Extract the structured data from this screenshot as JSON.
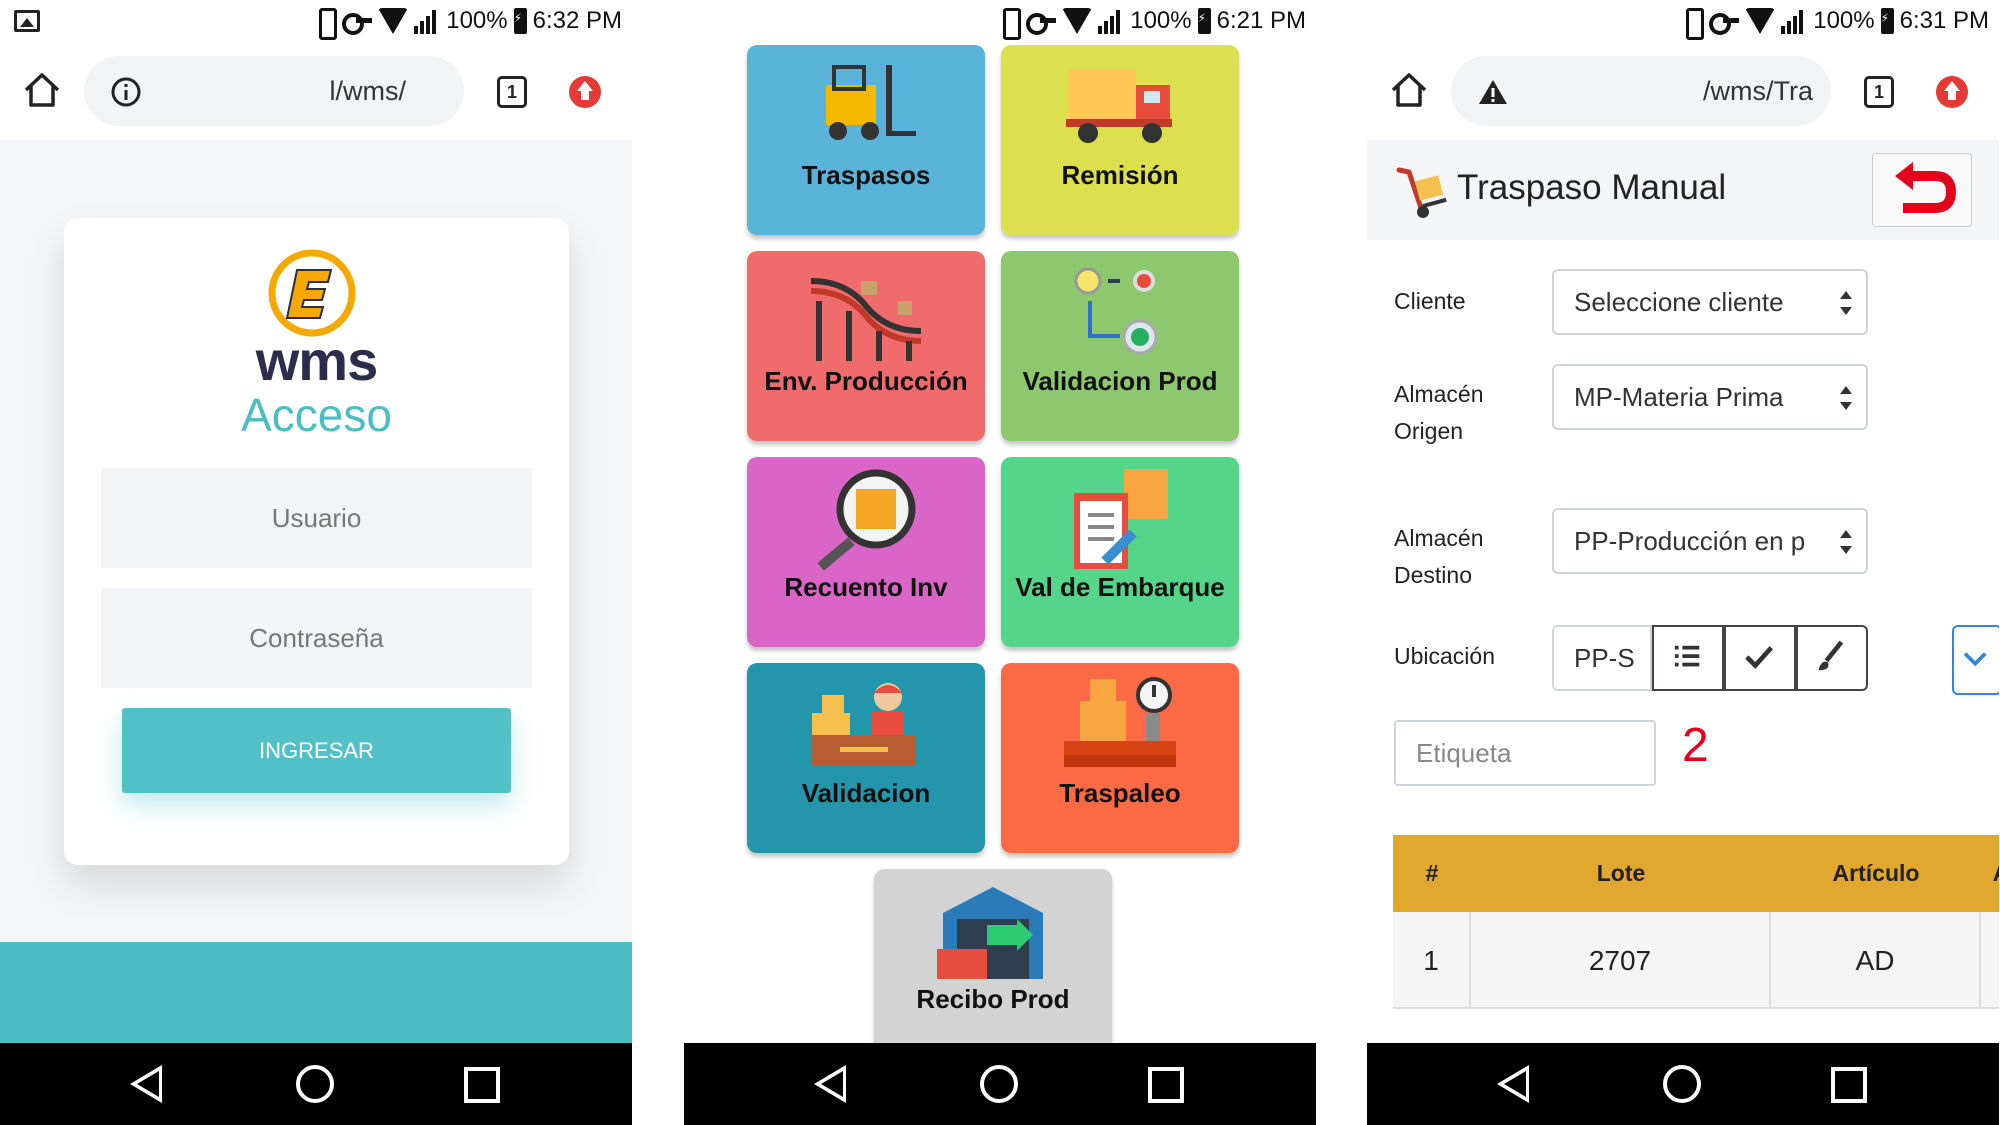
{
  "status_bars": [
    {
      "battery": "100%",
      "time": "6:32 PM"
    },
    {
      "battery": "100%",
      "time": "6:21 PM"
    },
    {
      "battery": "100%",
      "time": "6:31 PM"
    }
  ],
  "login_screen": {
    "url": "l/wms/",
    "tab_count": "1",
    "logo_text": "wms",
    "title": "Acceso",
    "username_placeholder": "Usuario",
    "password_placeholder": "Contraseña",
    "submit_label": "INGRESAR",
    "colors": {
      "accent": "#4dbdc4",
      "logo_orange": "#f5a800"
    }
  },
  "menu_screen": {
    "tiles": [
      {
        "label": "Traspasos",
        "color": "#5ab4d9",
        "icon": "forklift-icon"
      },
      {
        "label": "Remisión",
        "color": "#dce04e",
        "icon": "delivery-truck-icon"
      },
      {
        "label": "Env. Producción",
        "color": "#f06b6b",
        "icon": "conveyor-belt-icon"
      },
      {
        "label": "Validacion Prod",
        "color": "#8dc86f",
        "icon": "flow-checkpoint-icon"
      },
      {
        "label": "Recuento Inv",
        "color": "#d966c6",
        "icon": "magnifier-box-icon"
      },
      {
        "label": "Val de Embarque",
        "color": "#55d58a",
        "icon": "clipboard-boxes-icon"
      },
      {
        "label": "Validacion",
        "color": "#2496ab",
        "icon": "worker-desk-icon"
      },
      {
        "label": "Traspaleo",
        "color": "#fb6a45",
        "icon": "scale-boxes-icon"
      },
      {
        "label": "Recibo Prod",
        "color": "#d3d3d3",
        "icon": "warehouse-icon"
      }
    ]
  },
  "transfer_screen": {
    "url": "/wms/Tra",
    "tab_count": "1",
    "title": "Traspaso Manual",
    "fields": {
      "cliente_label": "Cliente",
      "cliente_value": "Seleccione cliente",
      "origen_label_1": "Almacén",
      "origen_label_2": "Origen",
      "origen_value": "MP-Materia Prima",
      "destino_label_1": "Almacén",
      "destino_label_2": "Destino",
      "destino_value": "PP-Producción en p",
      "ubicacion_label": "Ubicación",
      "ubicacion_value": "PP-S",
      "etiqueta_placeholder": "Etiqueta",
      "count": "2"
    },
    "table": {
      "columns": [
        "#",
        "Lote",
        "Artículo",
        "A"
      ],
      "rows": [
        [
          "1",
          "2707",
          "AD"
        ]
      ]
    },
    "colors": {
      "table_header": "#e0a82e",
      "count": "#e3001b"
    }
  }
}
